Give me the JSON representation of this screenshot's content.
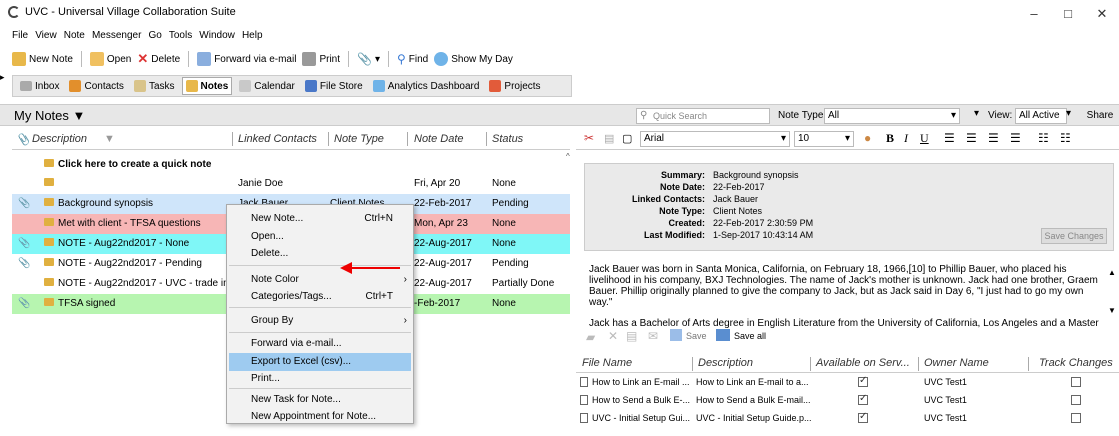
{
  "window": {
    "title": "UVC - Universal Village Collaboration Suite",
    "minimize": "–",
    "maximize": "□",
    "close": "✕"
  },
  "menu": [
    "File",
    "View",
    "Note",
    "Messenger",
    "Go",
    "Tools",
    "Window",
    "Help"
  ],
  "toolbar": {
    "new_note": "New Note",
    "open": "Open",
    "delete": "Delete",
    "forward": "Forward via e-mail",
    "print": "Print",
    "find": "Find",
    "show_my_day": "Show My Day"
  },
  "nav_tabs": [
    "Inbox",
    "Contacts",
    "Tasks",
    "Notes",
    "Calendar",
    "File Store",
    "Analytics Dashboard",
    "Projects"
  ],
  "header": {
    "title": "My Notes ▼",
    "quick_search_placeholder": "Quick Search",
    "note_type_label": "Note Type:",
    "note_type_value": "All",
    "view_label": "View:",
    "view_value": "All Active",
    "share": "Share"
  },
  "grid": {
    "columns": [
      "Description",
      "Linked Contacts",
      "Note Type",
      "Note Date",
      "Status"
    ],
    "quick_note": "Click here to create a quick note",
    "rows": [
      {
        "description": "",
        "contact": "Janie Doe",
        "type": "",
        "date": "Fri, Apr 20",
        "status": "None",
        "bg": "#ffffff",
        "clip": false
      },
      {
        "description": "Background synopsis",
        "contact": "Jack Bauer",
        "type": "Client Notes",
        "date": "22-Feb-2017",
        "status": "Pending",
        "bg": "#cfe5fa",
        "clip": true
      },
      {
        "description": "Met with client - TFSA questions",
        "contact": "",
        "type": "",
        "date": "Mon, Apr 23",
        "status": "None",
        "bg": "#f7b6b6",
        "clip": false
      },
      {
        "description": "NOTE - Aug22nd2017 - None",
        "contact": "",
        "type": "",
        "date": "22-Aug-2017",
        "status": "None",
        "bg": "#7ff7f7",
        "clip": true
      },
      {
        "description": "NOTE - Aug22nd2017 - Pending",
        "contact": "",
        "type": "",
        "date": "22-Aug-2017",
        "status": "Pending",
        "bg": "#ffffff",
        "clip": true
      },
      {
        "description": "NOTE - Aug22nd2017 - UVC - trade info",
        "contact": "",
        "type": "",
        "date": "22-Aug-2017",
        "status": "Partially Done",
        "bg": "#ffffff",
        "clip": false
      },
      {
        "description": "TFSA signed",
        "contact": "",
        "type": "",
        "date": "-Feb-2017",
        "status": "None",
        "bg": "#b7f5b0",
        "clip": true
      }
    ]
  },
  "context_menu": {
    "items": [
      {
        "label": "New Note...",
        "shortcut": "Ctrl+N"
      },
      {
        "label": "Open...",
        "shortcut": ""
      },
      {
        "label": "Delete...",
        "shortcut": ""
      },
      {
        "label": "Note Color",
        "shortcut": "›"
      },
      {
        "label": "Categories/Tags...",
        "shortcut": "Ctrl+T"
      },
      {
        "label": "Group By",
        "shortcut": "›"
      },
      {
        "label": "Forward via e-mail...",
        "shortcut": ""
      },
      {
        "label": "Export to Excel (csv)...",
        "shortcut": ""
      },
      {
        "label": "Print...",
        "shortcut": ""
      },
      {
        "label": "New Task for Note...",
        "shortcut": ""
      },
      {
        "label": "New Appointment for Note...",
        "shortcut": ""
      }
    ]
  },
  "editor": {
    "font": "Arial",
    "size": "10",
    "summary": {
      "summary_label": "Summary:",
      "summary_value": "Background synopsis",
      "date_label": "Note Date:",
      "date_value": "22-Feb-2017",
      "contacts_label": "Linked Contacts:",
      "contacts_value": "Jack Bauer",
      "type_label": "Note Type:",
      "type_value": "Client Notes",
      "created_label": "Created:",
      "created_value": "22-Feb-2017 2:30:59 PM",
      "modified_label": "Last Modified:",
      "modified_value": "1-Sep-2017 10:43:14 AM",
      "save_changes": "Save Changes"
    },
    "body_p1": "Jack Bauer was born in Santa Monica, California, on February 18, 1966,[10] to Phillip Bauer, who placed his livelihood in his company, BXJ Technologies. The name of Jack's mother is unknown. Jack had one brother, Graem Bauer. Phillip originally planned to give the company to Jack, but as Jack said in Day 6, \"I just had to go my own way.\"",
    "body_p2": "Jack has a Bachelor of Arts degree in English Literature from the University of California, Los Angeles and a Master of"
  },
  "attachments": {
    "save": "Save",
    "save_all": "Save all",
    "columns": [
      "File Name",
      "Description",
      "Available on Serv...",
      "Owner Name",
      "Track Changes"
    ],
    "rows": [
      {
        "file": "How to Link an E-mail ...",
        "desc": "How to Link an E-mail to a...",
        "avail": true,
        "owner": "UVC Test1",
        "track": false
      },
      {
        "file": "How to Send a Bulk E-...",
        "desc": "How to Send a Bulk E-mail...",
        "avail": true,
        "owner": "UVC Test1",
        "track": false
      },
      {
        "file": "UVC - Initial Setup Gui...",
        "desc": "UVC - Initial Setup Guide.p...",
        "avail": true,
        "owner": "UVC Test1",
        "track": false
      }
    ]
  }
}
